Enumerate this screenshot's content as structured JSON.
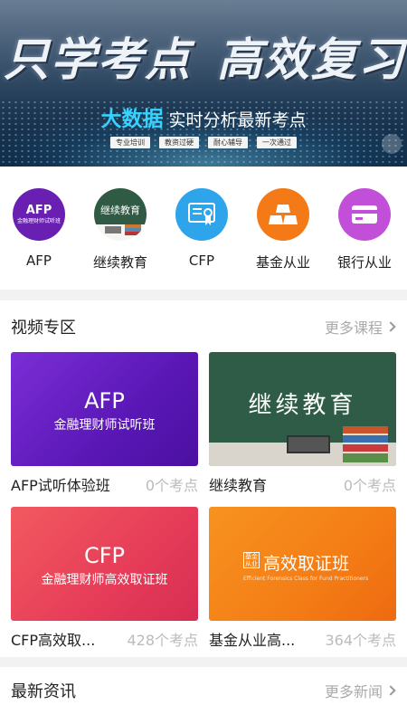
{
  "banner": {
    "slogan_left": "只学考点",
    "slogan_right": "高效复习",
    "sub_highlight": "大数据",
    "sub_rest": "实时分析最新考点",
    "tags": [
      "专业培训",
      "教资过硬",
      "耐心辅导",
      "一次通过"
    ]
  },
  "categories": [
    {
      "label": "AFP",
      "icon": "afp-logo-icon",
      "icon_text": "AFP",
      "icon_sub": "金融理财师试听班",
      "color": "#6a1fb3"
    },
    {
      "label": "继续教育",
      "icon": "blackboard-icon",
      "icon_text": "继续教育",
      "color": "#2f5a44"
    },
    {
      "label": "CFP",
      "icon": "certificate-icon",
      "color": "#2ea4ea"
    },
    {
      "label": "基金从业",
      "icon": "gold-bars-icon",
      "color": "#f47a17"
    },
    {
      "label": "银行从业",
      "icon": "bank-card-icon",
      "color": "#c24fd8"
    }
  ],
  "video_section": {
    "title": "视频专区",
    "more": "更多课程",
    "courses": [
      {
        "title": "AFP试听体验班",
        "count": "0个考点",
        "thumb_big": "AFP",
        "thumb_small": "金融理财师试听班"
      },
      {
        "title": "继续教育",
        "count": "0个考点",
        "thumb_big": "继续教育"
      },
      {
        "title": "CFP高效取...",
        "count": "428个考点",
        "thumb_big": "CFP",
        "thumb_small": "金融理财师高效取证班"
      },
      {
        "title": "基金从业高...",
        "count": "364个考点",
        "thumb_big": "高效取证班",
        "thumb_box": "基金从业",
        "thumb_sub": "Efficient Forensics Class for Fund Practitioners"
      }
    ]
  },
  "news_section": {
    "title": "最新资讯",
    "more": "更多新闻"
  }
}
